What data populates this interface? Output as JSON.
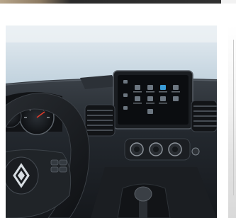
{
  "image": {
    "subject": "van-cabin-dashboard",
    "brand_logo_icon": "renault-diamond-icon",
    "colors": {
      "sky": "#cfdde8",
      "dashboard": "#1f2328",
      "screen": "#0b0d10",
      "accent": "#3a9bd6"
    }
  }
}
